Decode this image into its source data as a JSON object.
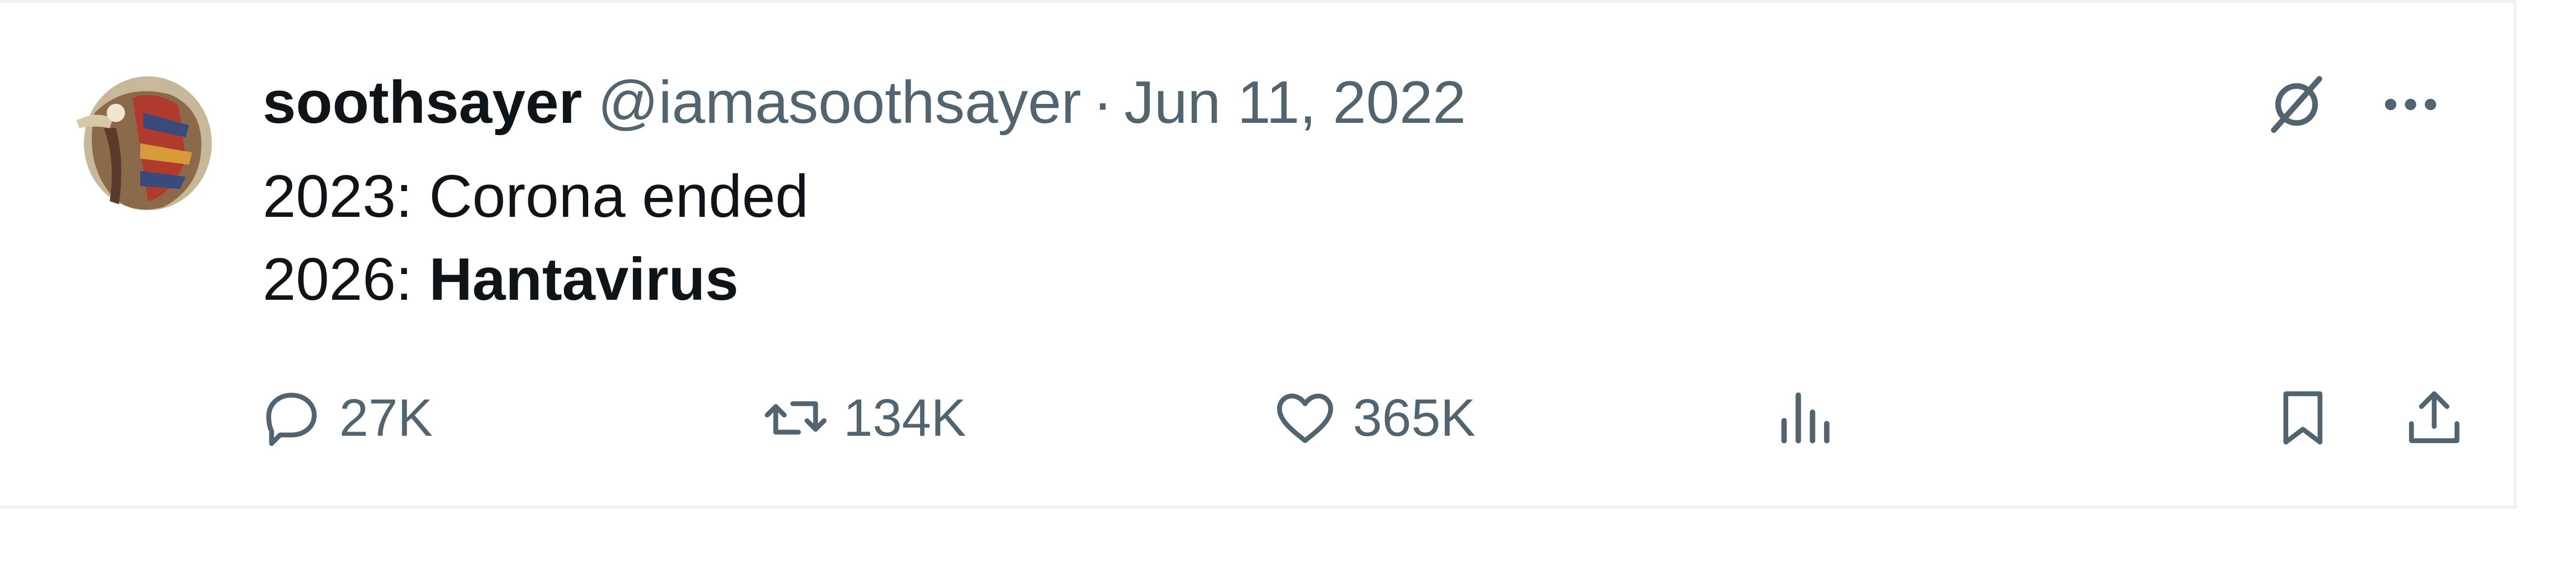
{
  "tweet": {
    "display_name": "soothsayer",
    "handle": "@iamasoothsayer",
    "separator": "·",
    "date": "Jun 11, 2022",
    "lines": [
      {
        "prefix": "2023: ",
        "emphasis": "Corona ended",
        "emphasis_bold": false
      },
      {
        "prefix": "2026: ",
        "emphasis": "Hantavirus",
        "emphasis_bold": true
      }
    ]
  },
  "actions": {
    "replies": "27K",
    "reposts": "134K",
    "likes": "365K"
  },
  "icons": {
    "grok": "grok-icon",
    "more": "more-icon",
    "reply": "reply-icon",
    "repost": "repost-icon",
    "like": "heart-icon",
    "views": "views-icon",
    "bookmark": "bookmark-icon",
    "share": "share-icon"
  },
  "colors": {
    "text_primary": "#0f1419",
    "text_secondary": "#536471",
    "border": "#eff3f4"
  }
}
